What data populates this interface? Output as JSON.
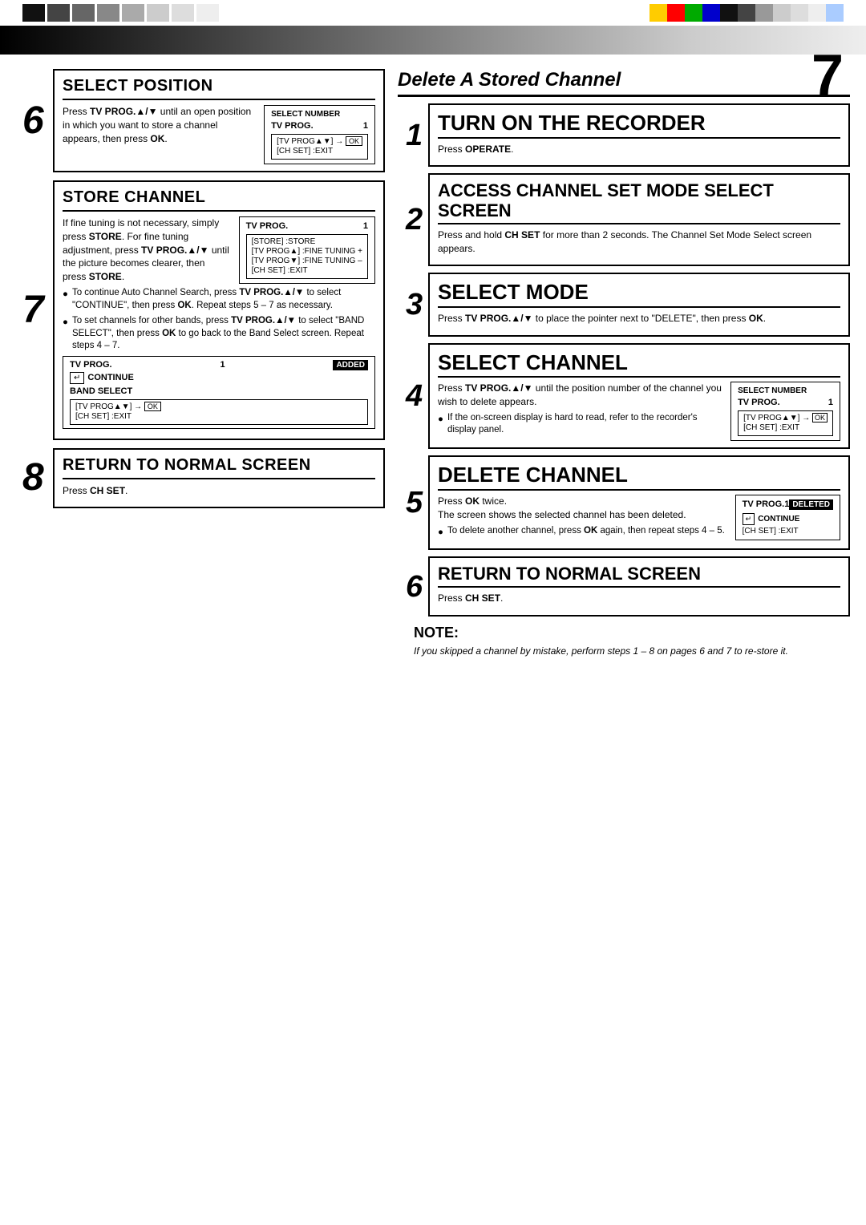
{
  "page": {
    "number": "7",
    "color_blocks_left": [
      "#000",
      "#333",
      "#666",
      "#888",
      "#aaa",
      "#ccc",
      "#ddd",
      "#eee"
    ],
    "color_blocks_right": [
      "#ffcc00",
      "#ff0000",
      "#00aa00",
      "#0000cc",
      "#000",
      "#333",
      "#999",
      "#ccc",
      "#ddd",
      "#eee",
      "#99ccff"
    ]
  },
  "left": {
    "select_position": {
      "title": "SELECT POSITION",
      "step_number": "6",
      "body": "Press TV PROG.▲/▼ until an open position in which you want to store a channel appears, then press OK.",
      "info_box": {
        "title": "SELECT NUMBER",
        "label": "TV PROG.",
        "value": "1"
      },
      "nav_keys": "[TV PROG▲▼] → OK\n[CH SET] :EXIT"
    },
    "store_channel": {
      "title": "STORE CHANNEL",
      "step_number": "7",
      "body1": "If fine tuning is not necessary, simply press STORE. For fine tuning adjustment, press TV PROG.▲/▼ until the picture becomes clearer, then press STORE.",
      "info_box": {
        "label": "TV PROG.",
        "value": "1",
        "keys": "[STORE] :STORE\n[TV PROG▲] :FINE TUNING +\n[TV PROG▼] :FINE TUNING –\n[CH SET] :EXIT"
      },
      "bullets": [
        "To continue Auto Channel Search, press TV PROG.▲/▼ to select \"CONTINUE\", then press OK. Repeat steps 5 – 7 as necessary.",
        "To set channels for other bands, press TV PROG.▲/▼ to select \"BAND SELECT\", then press OK to go back to the Band Select screen. Repeat steps 4 – 7."
      ],
      "display_box": {
        "label": "TV PROG.",
        "value": "1",
        "badge": "ADDED",
        "continue": "CONTINUE",
        "band": "BAND SELECT",
        "nav": "[TV PROG▲▼] → OK\n[CH SET] :EXIT"
      }
    },
    "return_normal": {
      "title": "RETURN TO NORMAL SCREEN",
      "step_number": "8",
      "body": "Press CH SET."
    }
  },
  "right": {
    "header": "Delete A Stored Channel",
    "turn_on": {
      "title": "TURN ON THE RECORDER",
      "step_number": "1",
      "body": "Press OPERATE."
    },
    "access_channel": {
      "title": "ACCESS CHANNEL SET MODE SELECT SCREEN",
      "step_number": "2",
      "body": "Press and hold CH SET for more than 2 seconds. The Channel Set Mode Select screen appears."
    },
    "select_mode": {
      "title": "SELECT MODE",
      "step_number": "3",
      "body": "Press TV PROG.▲/▼ to place the pointer next to \"DELETE\", then press OK."
    },
    "select_channel": {
      "title": "SELECT CHANNEL",
      "step_number": "4",
      "body": "Press TV PROG.▲/▼ until the position number of the channel you wish to delete appears.",
      "info_box": {
        "title": "SELECT NUMBER",
        "label": "TV PROG.",
        "value": "1"
      },
      "nav_keys": "[TV PROG▲▼] → OK\n[CH SET] :EXIT",
      "bullet": "If the on-screen display is hard to read, refer to the recorder's display panel."
    },
    "delete_channel": {
      "title": "DELETE CHANNEL",
      "step_number": "5",
      "body": "Press OK twice.\nThe screen shows the selected channel has been deleted.",
      "info_box": {
        "label": "TV PROG.",
        "value": "1",
        "badge": "DELETED"
      },
      "bullet": "To delete another channel, press OK again, then repeat steps 4 – 5.",
      "continue_box": "CONTINUE",
      "exit": "[CH SET] :EXIT"
    },
    "return_normal": {
      "title": "RETURN TO NORMAL SCREEN",
      "step_number": "6",
      "body": "Press CH SET."
    }
  },
  "note": {
    "title": "NOTE:",
    "body": "If you skipped a channel by mistake, perform steps 1 – 8 on pages 6 and 7 to re-store it."
  }
}
